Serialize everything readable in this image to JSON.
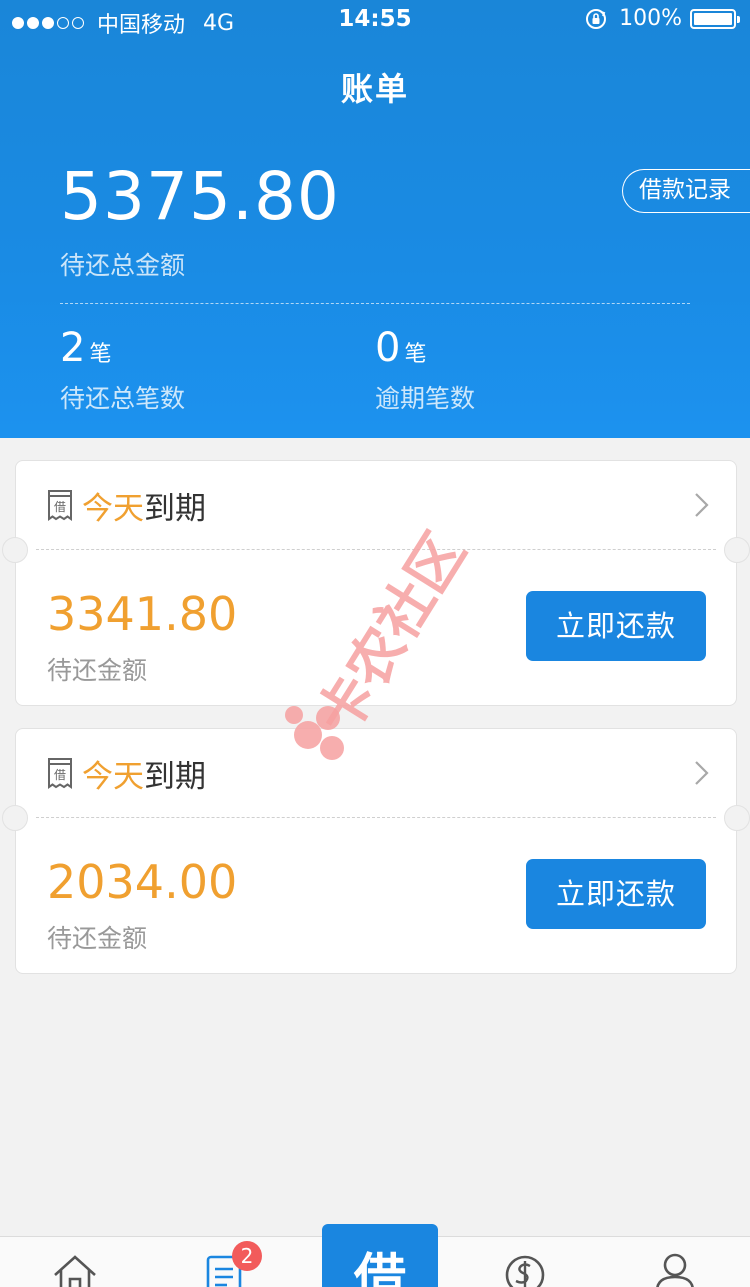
{
  "status_bar": {
    "carrier": "中国移动",
    "network": "4G",
    "time": "14:55",
    "battery": "100%",
    "signal_strength": 3,
    "signal_max": 5
  },
  "nav": {
    "title": "账单"
  },
  "summary": {
    "total_amount": "5375.80",
    "total_label": "待还总金额",
    "record_button": "借款记录",
    "pending_count": "2",
    "pending_unit": "笔",
    "pending_label": "待还总笔数",
    "overdue_count": "0",
    "overdue_unit": "笔",
    "overdue_label": "逾期笔数"
  },
  "bills": [
    {
      "due_highlight": "今天",
      "due_suffix": "到期",
      "amount": "3341.80",
      "amount_label": "待还金额",
      "pay_button": "立即还款",
      "doc_icon_text": "借"
    },
    {
      "due_highlight": "今天",
      "due_suffix": "到期",
      "amount": "2034.00",
      "amount_label": "待还金额",
      "pay_button": "立即还款",
      "doc_icon_text": "借"
    }
  ],
  "watermark": {
    "text": "卡农社区"
  },
  "tabbar": {
    "badge_count": "2",
    "center_label": "借",
    "icons": [
      "home-icon",
      "bill-icon",
      "loan-icon",
      "dollar-icon",
      "user-icon"
    ]
  },
  "colors": {
    "header_blue": "#1a8be4",
    "accent_orange": "#f0a030",
    "button_blue": "#1a86e0",
    "badge_red": "#f25b5b"
  }
}
